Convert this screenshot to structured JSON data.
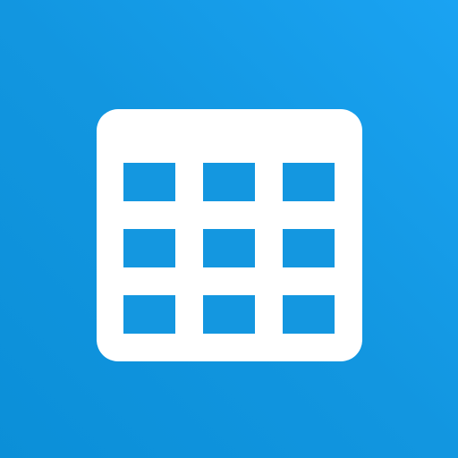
{
  "app_icon": {
    "name": "calendar-grid-icon",
    "colors": {
      "background_start": "#0b8fd8",
      "background_end": "#1aa3f2",
      "tile": "#ffffff",
      "cell": "#1497e0"
    },
    "grid": {
      "rows": 3,
      "columns": 3
    }
  }
}
